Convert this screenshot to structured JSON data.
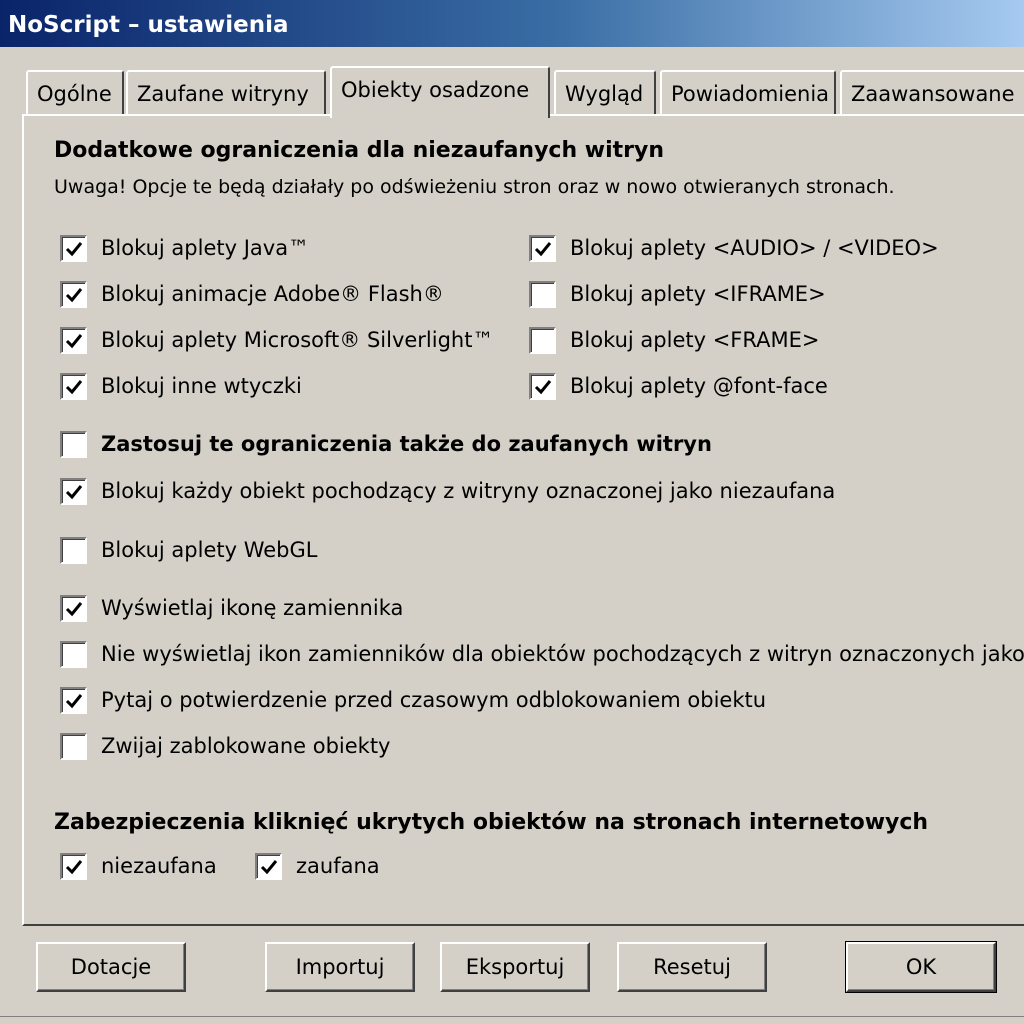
{
  "window": {
    "title": "NoScript – ustawienia"
  },
  "tabs": [
    {
      "label": "Ogólne",
      "active": false
    },
    {
      "label": "Zaufane witryny",
      "active": false
    },
    {
      "label": "Obiekty osadzone",
      "active": true
    },
    {
      "label": "Wygląd",
      "active": false
    },
    {
      "label": "Powiadomienia",
      "active": false
    },
    {
      "label": "Zaawansowane",
      "active": false
    }
  ],
  "section1": {
    "heading": "Dodatkowe ograniczenia dla niezaufanych witryn",
    "note": "Uwaga! Opcje te będą działały po odświeżeniu stron oraz w nowo otwieranych stronach.",
    "left_options": [
      {
        "label": "Blokuj aplety Java™",
        "checked": true
      },
      {
        "label": "Blokuj animacje Adobe® Flash®",
        "checked": true
      },
      {
        "label": "Blokuj aplety Microsoft® Silverlight™",
        "checked": true
      },
      {
        "label": "Blokuj inne wtyczki",
        "checked": true
      }
    ],
    "right_options": [
      {
        "label": "Blokuj aplety <AUDIO> / <VIDEO>",
        "checked": true
      },
      {
        "label": "Blokuj aplety <IFRAME>",
        "checked": false
      },
      {
        "label": "Blokuj aplety <FRAME>",
        "checked": false
      },
      {
        "label": "Blokuj aplety @font-face",
        "checked": true
      }
    ]
  },
  "options": [
    {
      "label": "Zastosuj te ograniczenia także do zaufanych witryn",
      "checked": false,
      "bold": true
    },
    {
      "label": "Blokuj każdy obiekt pochodzący z witryny oznaczonej jako niezaufana",
      "checked": true
    },
    {
      "label": "Blokuj aplety WebGL",
      "checked": false
    },
    {
      "label": "Wyświetlaj ikonę zamiennika",
      "checked": true
    },
    {
      "label": "Nie wyświetlaj ikon zamienników dla obiektów pochodzących z witryn oznaczonych jako",
      "checked": false
    },
    {
      "label": "Pytaj o potwierdzenie przed czasowym odblokowaniem obiektu",
      "checked": true
    },
    {
      "label": "Zwijaj zablokowane obiekty",
      "checked": false
    }
  ],
  "clickjacking": {
    "heading": "Zabezpieczenia kliknięć ukrytych obiektów na stronach internetowych",
    "untrusted": {
      "label": "niezaufana",
      "checked": true
    },
    "trusted": {
      "label": "zaufana",
      "checked": true
    }
  },
  "buttons": {
    "donate": "Dotacje",
    "import": "Importuj",
    "export": "Eksportuj",
    "reset": "Resetuj",
    "ok": "OK"
  }
}
